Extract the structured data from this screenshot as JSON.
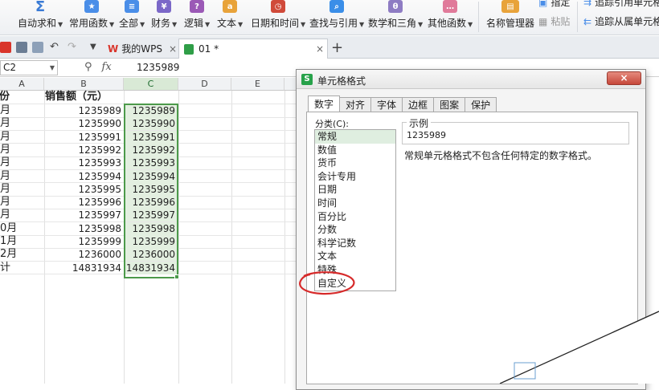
{
  "ribbon": {
    "buttons": [
      {
        "label": "自动求和",
        "icon": "sum-icon",
        "color": "#3a7bd5"
      },
      {
        "label": "常用函数",
        "icon": "star-icon",
        "color": "#4a8ee8"
      },
      {
        "label": "全部",
        "icon": "list-icon",
        "color": "#4a8ee8"
      },
      {
        "label": "财务",
        "icon": "finance-icon",
        "color": "#7b68c8"
      },
      {
        "label": "逻辑",
        "icon": "logic-icon",
        "color": "#9b59b6"
      },
      {
        "label": "文本",
        "icon": "text-icon",
        "color": "#e8a33a"
      },
      {
        "label": "日期和时间",
        "icon": "clock-icon",
        "color": "#d04a3a"
      },
      {
        "label": "查找与引用",
        "icon": "search-ref-icon",
        "color": "#3a8ee8"
      },
      {
        "label": "数学和三角",
        "icon": "math-icon",
        "color": "#8e7cc3"
      },
      {
        "label": "其他函数",
        "icon": "more-functions-icon",
        "color": "#e07a9a"
      }
    ],
    "name_manager": "名称管理器",
    "paste": "粘贴",
    "pointer_top": "指定",
    "trace_top": "追踪引用单元格",
    "trace_dependents": "追踪从属单元格"
  },
  "tabbar": {
    "wps_tab": "我的WPS",
    "file_tab": "01 *",
    "add_tab": "+"
  },
  "formula_bar": {
    "name_box": "C2",
    "fx": "fx",
    "value": "1235989"
  },
  "sheet": {
    "columns": [
      "A",
      "B",
      "C",
      "D",
      "E"
    ],
    "header_b": "销售额（元）",
    "header_a": "月份",
    "rows": [
      {
        "a": "月",
        "b": "1235989",
        "c": "1235989"
      },
      {
        "a": "月",
        "b": "1235990",
        "c": "1235990"
      },
      {
        "a": "月",
        "b": "1235991",
        "c": "1235991"
      },
      {
        "a": "月",
        "b": "1235992",
        "c": "1235992"
      },
      {
        "a": "月",
        "b": "1235993",
        "c": "1235993"
      },
      {
        "a": "月",
        "b": "1235994",
        "c": "1235994"
      },
      {
        "a": "月",
        "b": "1235995",
        "c": "1235995"
      },
      {
        "a": "月",
        "b": "1235996",
        "c": "1235996"
      },
      {
        "a": "月",
        "b": "1235997",
        "c": "1235997"
      },
      {
        "a": "0月",
        "b": "1235998",
        "c": "1235998"
      },
      {
        "a": "1月",
        "b": "1235999",
        "c": "1235999"
      },
      {
        "a": "2月",
        "b": "1236000",
        "c": "1236000"
      },
      {
        "a": "计",
        "b": "14831934",
        "c": "14831934"
      }
    ]
  },
  "dialog": {
    "title": "单元格格式",
    "close": "×",
    "tabs": [
      "数字",
      "对齐",
      "字体",
      "边框",
      "图案",
      "保护"
    ],
    "active_tab": "数字",
    "category_label": "分类(C):",
    "categories": [
      "常规",
      "数值",
      "货币",
      "会计专用",
      "日期",
      "时间",
      "百分比",
      "分数",
      "科学记数",
      "文本",
      "特殊",
      "自定义"
    ],
    "selected_category": "常规",
    "sample_label": "示例",
    "sample_value": "1235989",
    "description": "常规单元格格式不包含任何特定的数字格式。"
  },
  "colors": {
    "accent_green": "#4c9a4a",
    "selection_fill": "#e3efe0",
    "annotation_red": "#d62a2a",
    "wps_red": "#d9352b"
  }
}
